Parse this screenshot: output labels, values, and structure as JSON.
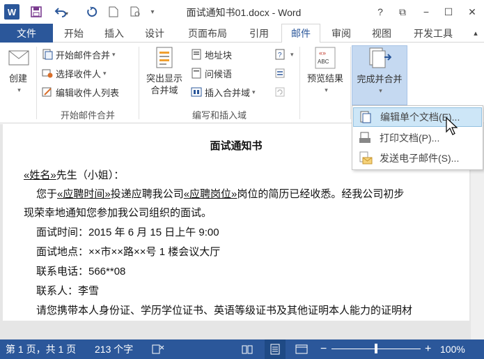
{
  "titlebar": {
    "app_letter": "W",
    "title": "面试通知书01.docx - Word",
    "help": "?",
    "restore": "⧉",
    "minimize": "−",
    "maximize": "☐",
    "close": "✕"
  },
  "tabs": {
    "file": "文件",
    "home": "开始",
    "insert": "插入",
    "design": "设计",
    "layout": "页面布局",
    "references": "引用",
    "mailings": "邮件",
    "review": "审阅",
    "view": "视图",
    "developer": "开发工具"
  },
  "ribbon": {
    "create": "创建",
    "start_merge": "开始邮件合并",
    "select_recipients": "选择收件人",
    "edit_recipients": "编辑收件人列表",
    "group_start": "开始邮件合并",
    "highlight_fields_1": "突出显示",
    "highlight_fields_2": "合并域",
    "address_block": "地址块",
    "greeting": "问候语",
    "insert_field": "插入合并域",
    "group_write": "编写和插入域",
    "preview": "预览结果",
    "finish": "完成并合并",
    "preview_icon_text": "ABC"
  },
  "dropdown": {
    "edit_docs": "编辑单个文档(E)...",
    "print_docs": "打印文档(P)...",
    "send_email": "发送电子邮件(S)..."
  },
  "document": {
    "title": "面试通知书",
    "name_field": "«姓名»",
    "salutation_rest": "先生（小姐）：",
    "p1_a": "您于",
    "p1_field1": "«应聘时间»",
    "p1_b": "投递应聘我公司",
    "p1_field2": "«应聘岗位»",
    "p1_c": "岗位的简历已经收悉。经我公司初步",
    "p1_line2": "现荣幸地通知您参加我公司组织的面试。",
    "time": "面试时间：2015 年 6 月 15 日上午 9:00",
    "place": "面试地点：××市××路××号 1 楼会议大厅",
    "phone": "联系电话：566**08",
    "contact": "联系人：李雪",
    "bring": "请您携带本人身份证、学历学位证书、英语等级证书及其他证明本人能力的证明材"
  },
  "statusbar": {
    "page": "第 1 页，共 1 页",
    "words": "213 个字",
    "zoom": "100%",
    "minus": "−",
    "plus": "+"
  },
  "colors": {
    "accent": "#2b579a",
    "hover": "#cde6f7"
  }
}
